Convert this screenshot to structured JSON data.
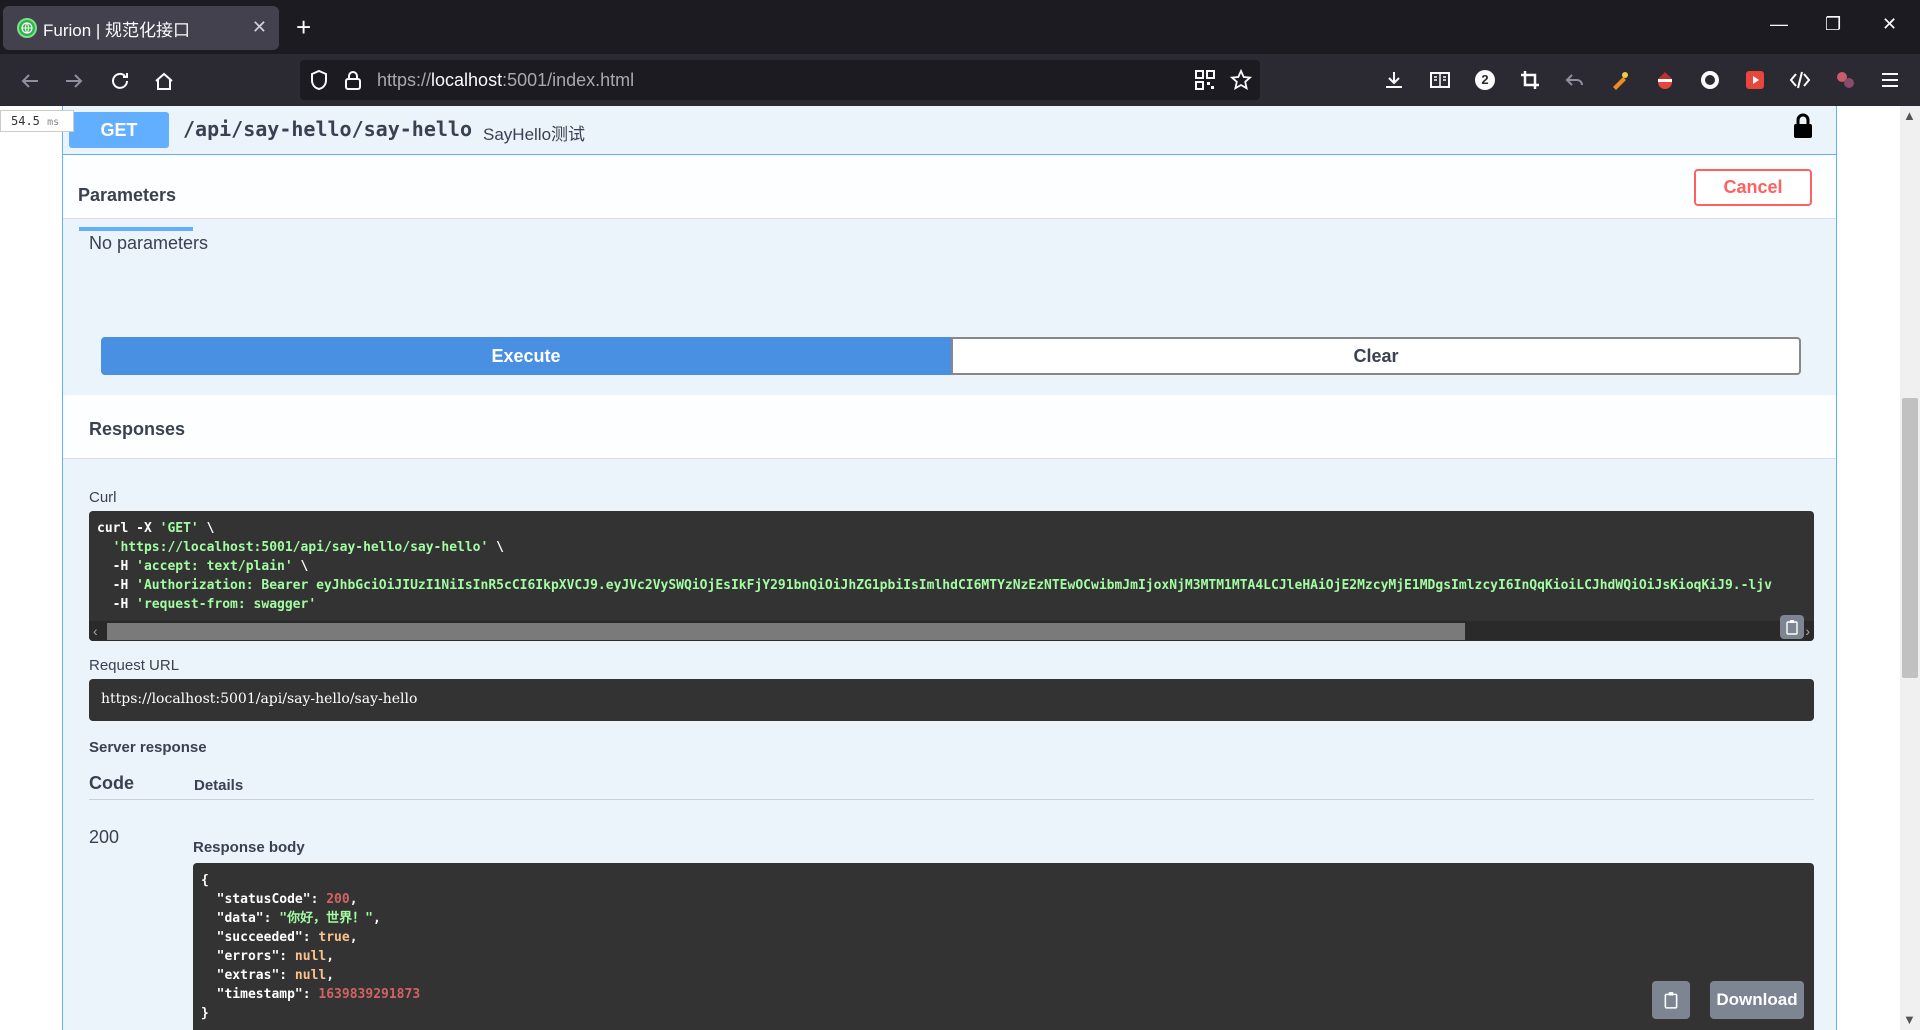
{
  "browser": {
    "tab_title": "Furion | 规范化接口",
    "tab_close": "✕",
    "new_tab": "+",
    "url_scheme": "https://",
    "url_host": "localhost",
    "url_rest": ":5001/index.html",
    "ext_badge": "2",
    "win_min": "—",
    "win_restore": "❐",
    "win_close": "✕"
  },
  "timing": {
    "value": "54.5",
    "unit": "ms"
  },
  "operation": {
    "method": "GET",
    "path": "/api/say-hello/say-hello",
    "description": "SayHello测试"
  },
  "parameters": {
    "tab_label": "Parameters",
    "cancel_label": "Cancel",
    "empty_text": "No parameters"
  },
  "actions": {
    "execute_label": "Execute",
    "clear_label": "Clear"
  },
  "responses": {
    "title": "Responses",
    "curl_label": "Curl",
    "curl_lines": [
      {
        "pre": "curl -X ",
        "str": "'GET'",
        "post": " \\"
      },
      {
        "pre": "  ",
        "str": "'https://localhost:5001/api/say-hello/say-hello'",
        "post": " \\"
      },
      {
        "pre": "  -H ",
        "str": "'accept: text/plain'",
        "post": " \\"
      },
      {
        "pre": "  -H ",
        "str": "'Authorization: Bearer eyJhbGciOiJIUzI1NiIsInR5cCI6IkpXVCJ9.eyJVc2VySWQiOjEsIkFjY291bnQiOiJhZG1pbiIsImlhdCI6MTYzNzEzNTEwOCwibmJmIjoxNjM3MTM1MTA4LCJleHAiOjE2MzcyMjE1MDgsImlzcyI6InQqKioiLCJhdWQiOiJsKioqKiJ9.-ljv",
        "post": ""
      },
      {
        "pre": "  -H ",
        "str": "'request-from: swagger'",
        "post": ""
      }
    ],
    "request_url_label": "Request URL",
    "request_url": "https://localhost:5001/api/say-hello/say-hello",
    "server_response_label": "Server response",
    "code_header": "Code",
    "details_header": "Details",
    "status_code": "200",
    "response_body_label": "Response body",
    "download_label": "Download",
    "body": {
      "statusCode": "200",
      "data": "\"你好，世界！\"",
      "succeeded": "true",
      "errors": "null",
      "extras": "null",
      "timestamp": "1639839291873"
    }
  },
  "colors": {
    "get_method": "#61affe",
    "execute": "#4990e2",
    "cancel": "#ff6060",
    "code_bg": "#333333"
  }
}
